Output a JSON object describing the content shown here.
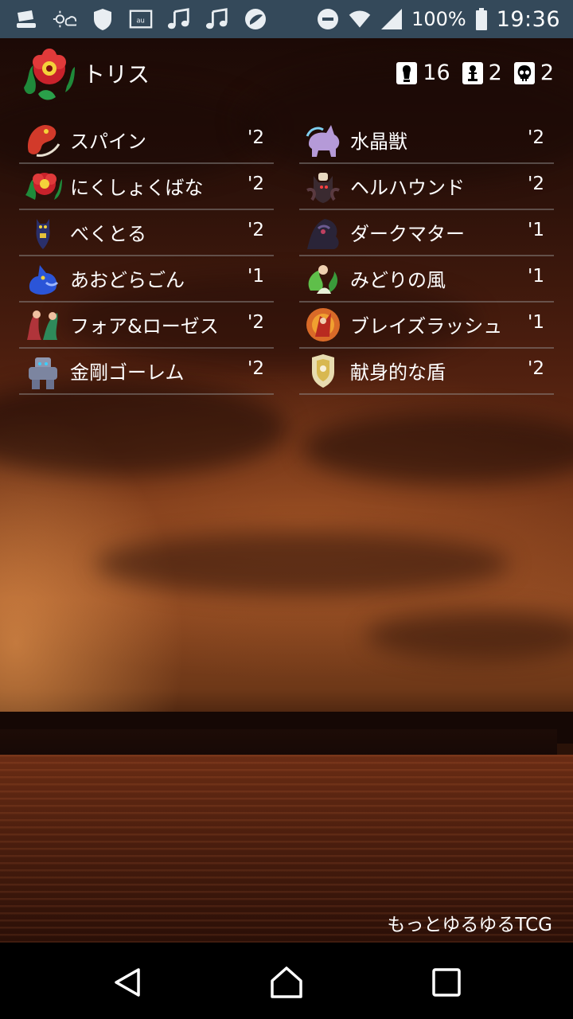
{
  "status_bar": {
    "battery": "100%",
    "time": "19:36",
    "icons": [
      "tray-icon",
      "weather-icon",
      "shield-icon",
      "au-mail-icon",
      "music-icon",
      "music-icon",
      "moon-icon",
      "dnd-icon",
      "wifi-icon",
      "signal-icon",
      "battery-icon"
    ]
  },
  "header": {
    "deck_name": "トリス",
    "stats": [
      {
        "icon": "card-stat-icon",
        "value": "16"
      },
      {
        "icon": "trap-stat-icon",
        "value": "2"
      },
      {
        "icon": "skull-stat-icon",
        "value": "2"
      }
    ]
  },
  "cards_left": [
    {
      "name": "スパイン",
      "count": "'2",
      "color": "#d23a2a"
    },
    {
      "name": "にくしょくばな",
      "count": "'2",
      "color": "#c9222b"
    },
    {
      "name": "べくとる",
      "count": "'2",
      "color": "#2a2f6a"
    },
    {
      "name": "あおどらごん",
      "count": "'1",
      "color": "#2b55d8"
    },
    {
      "name": "フォア&ローゼス",
      "count": "'2",
      "color": "#b0343a"
    },
    {
      "name": "金剛ゴーレム",
      "count": "'2",
      "color": "#8e97b0"
    }
  ],
  "cards_right": [
    {
      "name": "水晶獣",
      "count": "'2",
      "color": "#b59ad8"
    },
    {
      "name": "ヘルハウンド",
      "count": "'2",
      "color": "#3a2a30"
    },
    {
      "name": "ダークマター",
      "count": "'1",
      "color": "#2a2438"
    },
    {
      "name": "みどりの風",
      "count": "'1",
      "color": "#5fbf4a"
    },
    {
      "name": "ブレイズラッシュ",
      "count": "'1",
      "color": "#d96a28"
    },
    {
      "name": "献身的な盾",
      "count": "'2",
      "color": "#e8dcb0"
    }
  ],
  "footer": {
    "credit": "もっとゆるゆるTCG"
  },
  "nav": [
    "back-icon",
    "home-icon",
    "recents-icon"
  ]
}
